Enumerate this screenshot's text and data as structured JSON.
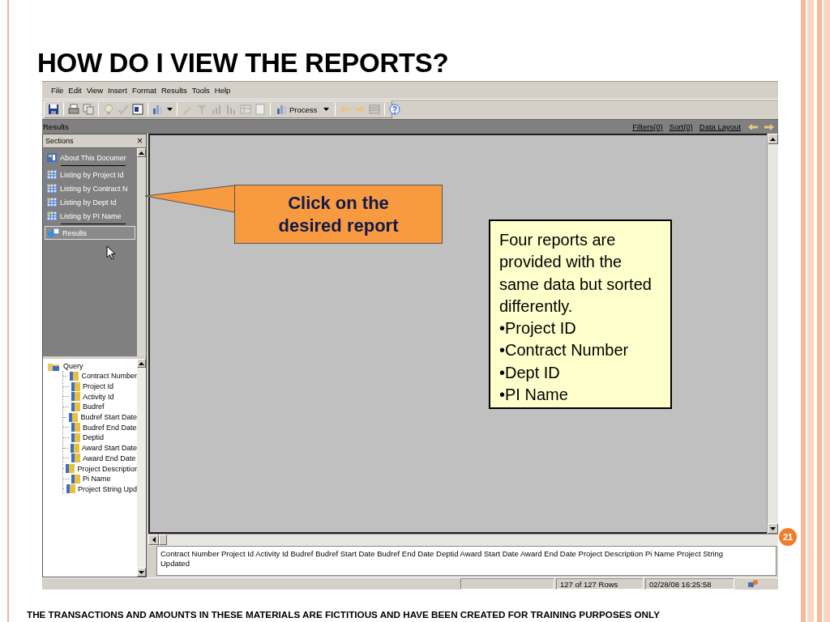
{
  "slide": {
    "title": "HOW DO I VIEW THE REPORTS?",
    "page_number": "21",
    "footer": "THE TRANSACTIONS AND AMOUNTS IN THESE MATERIALS ARE FICTITIOUS AND HAVE BEEN CREATED FOR TRAINING PURPOSES ONLY"
  },
  "app": {
    "menu": [
      "File",
      "Edit",
      "View",
      "Insert",
      "Format",
      "Results",
      "Tools",
      "Help"
    ],
    "toolbar": {
      "process_label": "Process"
    },
    "results_bar": {
      "title": "Results",
      "links": [
        "Filters(0)",
        "Sort(0)",
        "Data Layout"
      ]
    },
    "sections": {
      "title": "Sections",
      "close": "×",
      "items": [
        {
          "label": "About This Documer",
          "kind": "document",
          "selected": false
        },
        {
          "label": "Listing by Project Id",
          "kind": "report",
          "selected": false
        },
        {
          "label": "Listing by Contract N",
          "kind": "report",
          "selected": false
        },
        {
          "label": "Listing by Dept Id",
          "kind": "report",
          "selected": false
        },
        {
          "label": "Listing by PI Name",
          "kind": "report",
          "selected": false
        },
        {
          "label": "Results",
          "kind": "results",
          "selected": true
        }
      ]
    },
    "query": {
      "label": "Query",
      "children": [
        {
          "label": "Contract Number"
        },
        {
          "label": "Project Id"
        },
        {
          "label": "Activity Id"
        },
        {
          "label": "Budref"
        },
        {
          "label": "Budref Start Date"
        },
        {
          "label": "Budref End Date"
        },
        {
          "label": "Deptid"
        },
        {
          "label": "Award Start Date"
        },
        {
          "label": "Award End Date"
        },
        {
          "label": "Project Descriptior"
        },
        {
          "label": "Pi Name"
        },
        {
          "label": "Project String Upd"
        }
      ]
    },
    "fields_text": "Contract Number  Project Id  Activity Id  Budref  Budref Start Date  Budref End Date  Deptid  Award Start Date  Award End Date  Project Description  Pi Name  Project String Updated",
    "status_bar": {
      "rows": "127 of 127 Rows",
      "timestamp": "02/28/08 16:25:58"
    }
  },
  "callout": {
    "text": "Click on the desired report"
  },
  "note": {
    "text": "Four reports are provided with the same data but sorted differently.",
    "bullets": [
      "•Project ID",
      "•Contract Number",
      "•Dept ID",
      "•PI Name"
    ]
  }
}
